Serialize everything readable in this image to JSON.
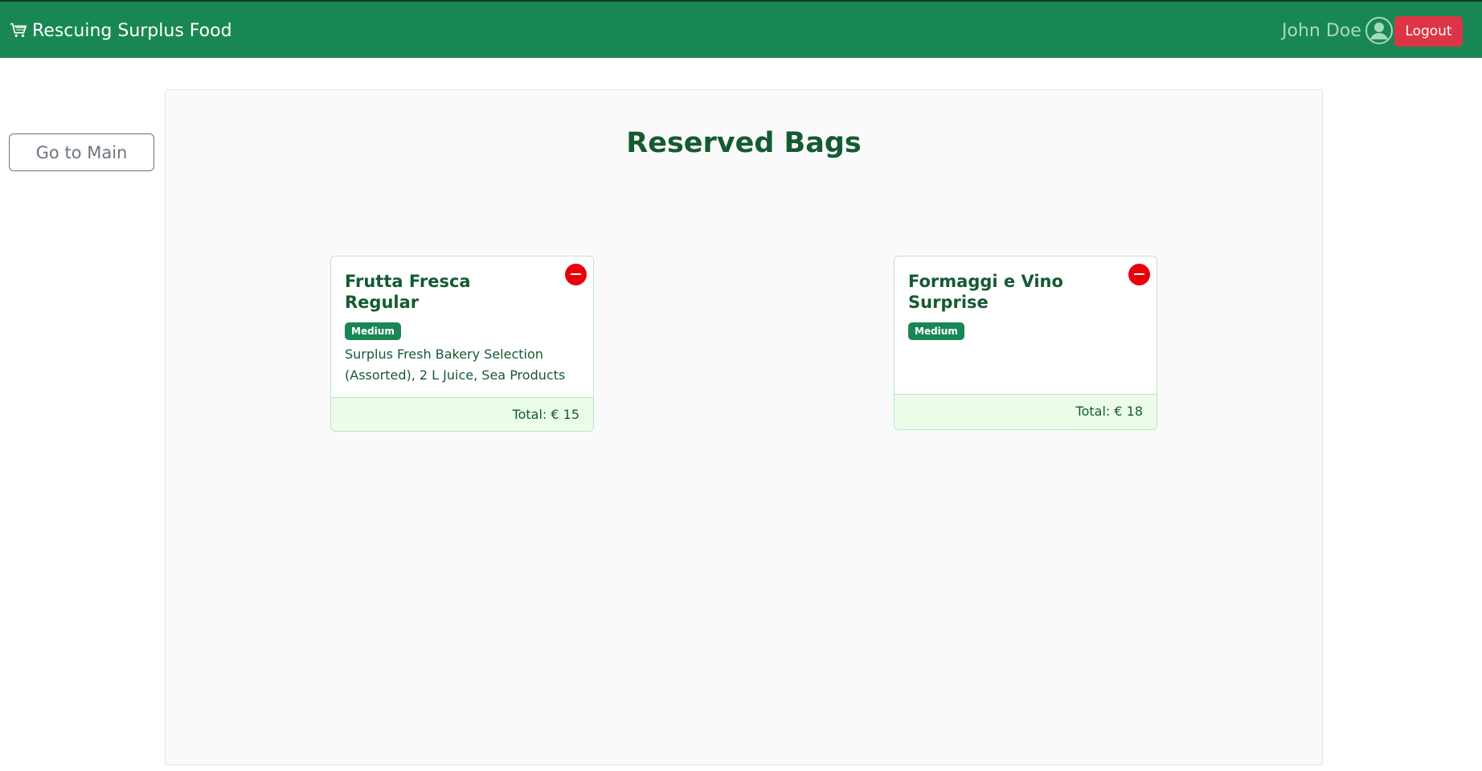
{
  "navbar": {
    "brand_label": "Rescuing Surplus Food",
    "brand_icon": "cart-icon",
    "user_name": "John Doe",
    "user_icon": "user-circle-icon",
    "logout_label": "Logout"
  },
  "sidebar": {
    "go_main_label": "Go to Main"
  },
  "main": {
    "title": "Reserved Bags",
    "bags": [
      {
        "title": "Frutta Fresca Regular",
        "size": "Medium",
        "description": "Surplus Fresh Bakery Selection (Assorted), 2 L Juice, Sea Products",
        "total": "Total: € 15"
      },
      {
        "title": "Formaggi e Vino Surprise",
        "size": "Medium",
        "description": "",
        "total": "Total: € 18"
      }
    ]
  },
  "colors": {
    "navbar": "#198754",
    "logout": "#dc3545",
    "remove": "#e8000b",
    "title_text": "#145a32",
    "footer_bg": "#ebfce9"
  }
}
